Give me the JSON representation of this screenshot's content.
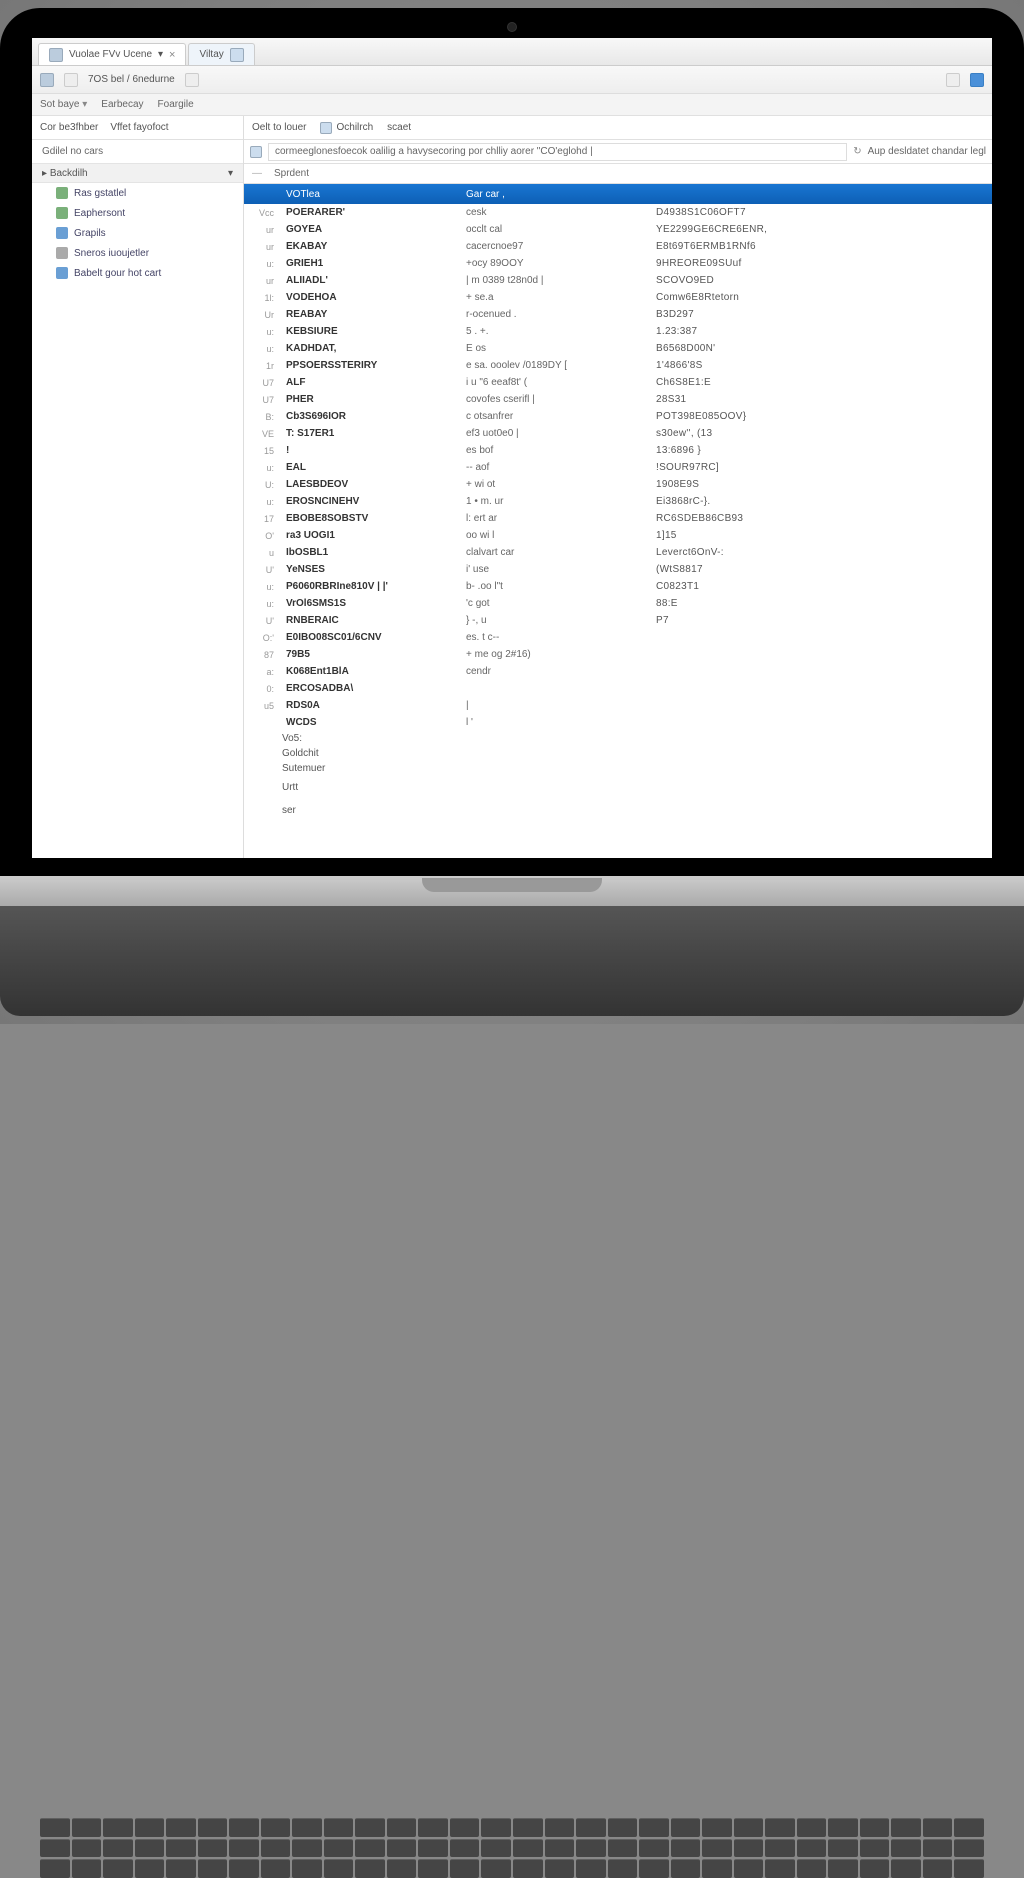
{
  "tabs": [
    {
      "label": "Vuolae  FVv Ucene",
      "closable": true
    },
    {
      "label": "Viltay",
      "closable": true
    }
  ],
  "toolbar1": {
    "item1": "7OS bel / 6nedurne",
    "item2": ""
  },
  "toolbar2": {
    "item1": "Sot baye",
    "item2": "Earbecay",
    "item3": "Foargile"
  },
  "sidebar": {
    "header1": "Cor be3fhber",
    "header2": "Vffet fayofoct",
    "sub": "Gdilel no cars",
    "group": "Backdilh",
    "items": [
      {
        "icon": "green",
        "label": "Ras gstatlel"
      },
      {
        "icon": "green",
        "label": "Eaphersont"
      },
      {
        "icon": "blue",
        "label": "Grapils"
      },
      {
        "icon": "gray",
        "label": "Sneros iuoujetler"
      },
      {
        "icon": "blue",
        "label": "Babelt gour hot cart"
      }
    ]
  },
  "content_toolbar": {
    "item1": "Oelt to louer",
    "item2": "Ochilrch",
    "item3": "scaet"
  },
  "pathbar": {
    "value": "cormeeglonesfoecok oalilig a havysecoring por chlliy aorer \"CO'eglohd |",
    "right_label": "Aup desldatet chandar legl"
  },
  "content_tab": "Sprdent",
  "columns": [
    "",
    "VOTlea",
    "Gar car  ,",
    ""
  ],
  "rows": [
    {
      "ix": "Vcc",
      "c1": "POERARER'",
      "c2": "cesk",
      "c3": "D4938S1C06OFT7"
    },
    {
      "ix": "ur",
      "c1": "GOYEA",
      "c2": "occlt  cal",
      "c3": "YE2299GE6CRE6ENR,"
    },
    {
      "ix": "ur",
      "c1": "EKABAY",
      "c2": "cacercnoe97",
      "c3": "E8t69T6ERMB1RNf6"
    },
    {
      "ix": "u:",
      "c1": "GRIEH1",
      "c2": "+ocy  89OOY",
      "c3": "9HREORE09SUuf"
    },
    {
      "ix": "ur",
      "c1": "ALIIADL'",
      "c2": "| m 0389  t28n0d  |",
      "c3": "SCOVO9ED"
    },
    {
      "ix": "1l:",
      "c1": "VODEHOA",
      "c2": "+ se.a",
      "c3": "Comw6E8Rtetorn"
    },
    {
      "ix": "Ur",
      "c1": "REABAY",
      "c2": "r-ocenued .",
      "c3": "B3D297"
    },
    {
      "ix": "u:",
      "c1": "KEBSIURE",
      "c2": "5 . +.",
      "c3": "1.23:387"
    },
    {
      "ix": "u:",
      "c1": "KADHDAT,",
      "c2": "E os",
      "c3": "B6568D00N'"
    },
    {
      "ix": "1r",
      "c1": "PPSOERSSTERIRY",
      "c2": " e sa.   ooolev   /0189DY [",
      "c3": "1'4866'8S"
    },
    {
      "ix": "U7",
      "c1": "ALF",
      "c2": "i u \"6     eeaf8t'  (",
      "c3": "Ch6S8E1:E"
    },
    {
      "ix": "U7",
      "c1": "PHER",
      "c2": "covofes  cserifl |",
      "c3": "28S31"
    },
    {
      "ix": "B:",
      "c1": "Cb3S696IOR",
      "c2": "c otsanfrer",
      "c3": "POT398E085OOV}"
    },
    {
      "ix": "VE",
      "c1": "T:            S17ER1",
      "c2": "ef3      uot0e0 |",
      "c3": "s30ew'',  (13"
    },
    {
      "ix": "15",
      "c1": "!",
      "c2": "es bof",
      "c3": "13:6896 }"
    },
    {
      "ix": "u:",
      "c1": "EAL",
      "c2": "-- aof",
      "c3": "!SOUR97RC]"
    },
    {
      "ix": "U:",
      "c1": "LAESBDEOV",
      "c2": "+ wi ot",
      "c3": "1908E9S"
    },
    {
      "ix": "u:",
      "c1": "EROSNCINEHV",
      "c2": "1 • m. ur",
      "c3": "Ei3868rC-}."
    },
    {
      "ix": "17",
      "c1": "EBOBE8SOBSTV",
      "c2": "l: ert ar",
      "c3": "RC6SDEB86CB93"
    },
    {
      "ix": "O'",
      "c1": "ra3 UOGI1",
      "c2": "oo   wi l",
      "c3": "1]15"
    },
    {
      "ix": "u",
      "c1": "IbOSBL1",
      "c2": "clalvart  car",
      "c3": "Leverct6OnV-:"
    },
    {
      "ix": "U'",
      "c1": "YeNSES",
      "c2": "i' use",
      "c3": "(WtS8817"
    },
    {
      "ix": "u:",
      "c1": "P6060RBRIne810V | |'",
      "c2": "b- .oo l\"t",
      "c3": "C0823T1"
    },
    {
      "ix": "u:",
      "c1": "VrOl6SMS1S",
      "c2": "'c got",
      "c3": "88:E"
    },
    {
      "ix": "U'",
      "c1": "RNBERAIC",
      "c2": "}   -, u",
      "c3": "P7"
    },
    {
      "ix": "O:'",
      "c1": "E0IBO08SC01/6CNV",
      "c2": "es. t c--",
      "c3": ""
    },
    {
      "ix": "87",
      "c1": "79B5",
      "c2": "+ me og    2#16)",
      "c3": ""
    },
    {
      "ix": "a:",
      "c1": "K068Ent1BlA",
      "c2": "cendr",
      "c3": ""
    },
    {
      "ix": "0:",
      "c1": "ERCOSADBA\\",
      "c2": "",
      "c3": ""
    },
    {
      "ix": "u5",
      "c1": "RDS0A",
      "c2": "|",
      "c3": ""
    },
    {
      "ix": "",
      "c1": "WCDS",
      "c2": "l '",
      "c3": ""
    }
  ],
  "tail_items": [
    "Vo5:",
    "Goldchit",
    "Sutemuer",
    "",
    "Urtt",
    "",
    "",
    "ser"
  ]
}
